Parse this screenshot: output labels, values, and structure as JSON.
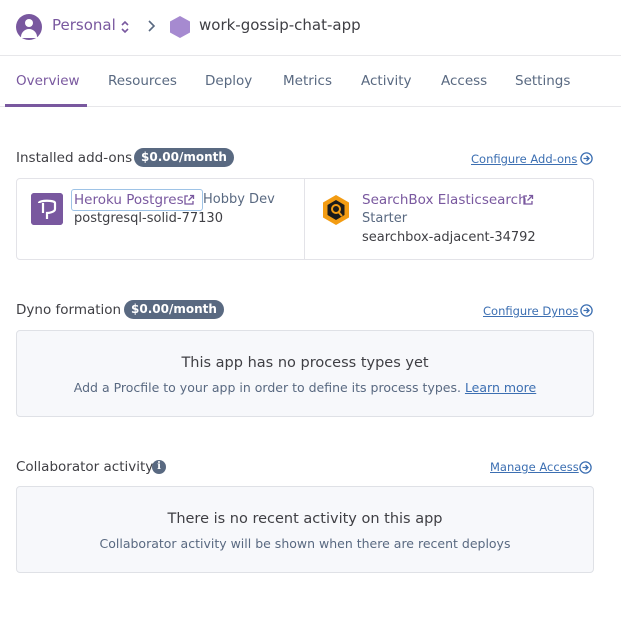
{
  "header": {
    "team": "Personal",
    "app_name": "work-gossip-chat-app"
  },
  "tabs": [
    {
      "label": "Overview",
      "active": true
    },
    {
      "label": "Resources"
    },
    {
      "label": "Deploy"
    },
    {
      "label": "Metrics"
    },
    {
      "label": "Activity"
    },
    {
      "label": "Access"
    },
    {
      "label": "Settings"
    }
  ],
  "addons": {
    "title": "Installed add-ons",
    "badge": "$0.00/month",
    "configure_link": "Configure Add-ons",
    "items": [
      {
        "name": "Heroku Postgres",
        "plan": "Hobby Dev",
        "id": "postgresql-solid-77130"
      },
      {
        "name": "SearchBox Elasticsearch",
        "plan": "Starter",
        "id": "searchbox-adjacent-34792"
      }
    ]
  },
  "dyno": {
    "title": "Dyno formation",
    "badge": "$0.00/month",
    "configure_link": "Configure Dynos",
    "empty_title": "This app has no process types yet",
    "empty_text": "Add a Procfile to your app in order to define its process types.",
    "learn_more": "Learn more"
  },
  "collaborators": {
    "title": "Collaborator activity",
    "info_glyph": "i",
    "manage_link": "Manage Access",
    "empty_title": "There is no recent activity on this app",
    "empty_text": "Collaborator activity will be shown when there are recent deploys"
  },
  "colors": {
    "accent": "#79589f",
    "link": "#3c6fb2",
    "badge": "#596981"
  }
}
